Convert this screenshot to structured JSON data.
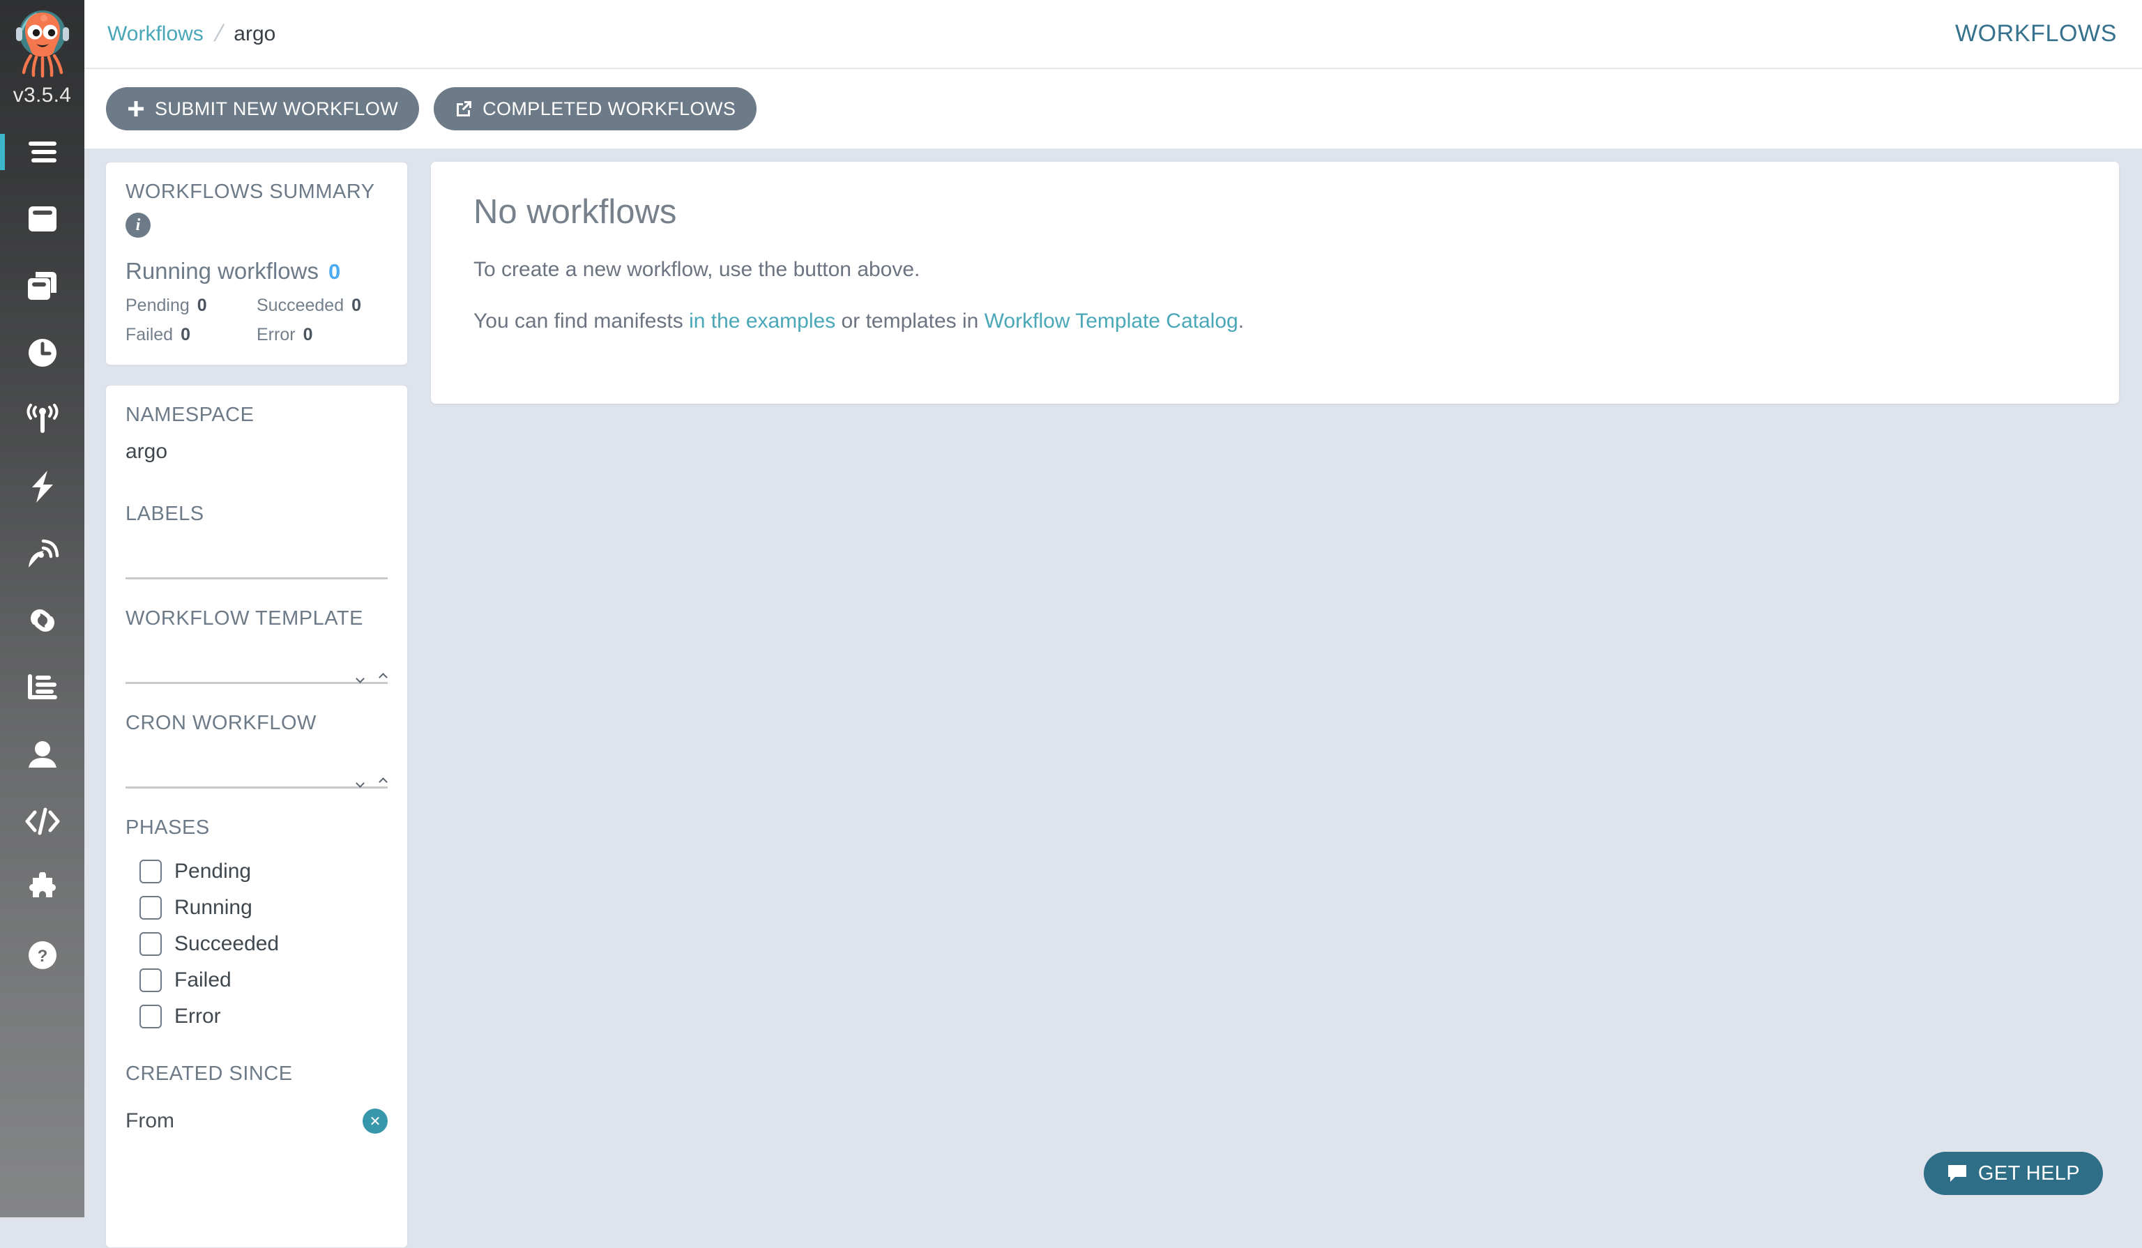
{
  "app": {
    "version": "v3.5.4",
    "logo_icon": "argo-octopus-logo"
  },
  "nav": {
    "items": [
      {
        "icon": "hamburger-menu-icon",
        "name": "nav-item-menu",
        "active": true
      },
      {
        "icon": "window-icon",
        "name": "nav-item-workflows",
        "active": false
      },
      {
        "icon": "copy-windows-icon",
        "name": "nav-item-workflow-templates",
        "active": false
      },
      {
        "icon": "clock-icon",
        "name": "nav-item-cron-workflows",
        "active": false
      },
      {
        "icon": "broadcast-tower-icon",
        "name": "nav-item-event-flow",
        "active": false
      },
      {
        "icon": "lightning-bolt-icon",
        "name": "nav-item-event-sources",
        "active": false
      },
      {
        "icon": "satellite-dish-icon",
        "name": "nav-item-sensors",
        "active": false
      },
      {
        "icon": "link-icon",
        "name": "nav-item-pipelines",
        "active": false
      },
      {
        "icon": "bar-chart-icon",
        "name": "nav-item-reports",
        "active": false
      },
      {
        "icon": "user-icon",
        "name": "nav-item-user",
        "active": false
      },
      {
        "icon": "code-brackets-icon",
        "name": "nav-item-api-docs",
        "active": false
      },
      {
        "icon": "puzzle-piece-icon",
        "name": "nav-item-plugins",
        "active": false
      },
      {
        "icon": "question-circle-icon",
        "name": "nav-item-help",
        "active": false
      }
    ]
  },
  "header": {
    "breadcrumb": {
      "root": "Workflows",
      "separator": "/",
      "current": "argo"
    },
    "title": "WORKFLOWS"
  },
  "action_bar": {
    "submit_label": "SUBMIT NEW WORKFLOW",
    "submit_icon": "plus-icon",
    "completed_label": "COMPLETED WORKFLOWS",
    "completed_icon": "external-link-icon"
  },
  "summary": {
    "title": "WORKFLOWS SUMMARY",
    "info_icon": "info-icon",
    "running_label": "Running workflows",
    "running_count": "0",
    "stats": [
      {
        "label": "Pending",
        "value": "0"
      },
      {
        "label": "Succeeded",
        "value": "0"
      },
      {
        "label": "Failed",
        "value": "0"
      },
      {
        "label": "Error",
        "value": "0"
      }
    ]
  },
  "filters": {
    "namespace_label": "NAMESPACE",
    "namespace_value": "argo",
    "labels_label": "LABELS",
    "labels_value": "",
    "workflow_template_label": "WORKFLOW TEMPLATE",
    "workflow_template_value": "",
    "cron_workflow_label": "CRON WORKFLOW",
    "cron_workflow_value": "",
    "phases_label": "PHASES",
    "phases": [
      {
        "label": "Pending",
        "checked": false
      },
      {
        "label": "Running",
        "checked": false
      },
      {
        "label": "Succeeded",
        "checked": false
      },
      {
        "label": "Failed",
        "checked": false
      },
      {
        "label": "Error",
        "checked": false
      }
    ],
    "created_since_label": "CREATED SINCE",
    "from_label": "From",
    "clear_icon": "close-circle-icon"
  },
  "content": {
    "empty_title": "No workflows",
    "empty_subtitle": "To create a new workflow, use the button above.",
    "hint_prefix": "You can find manifests ",
    "hint_link1": "in the examples",
    "hint_middle": " or templates in ",
    "hint_link2": "Workflow Template Catalog",
    "hint_suffix": "."
  },
  "help": {
    "label": "GET HELP",
    "icon": "chat-bubble-icon"
  },
  "colors": {
    "accent_teal": "#49a7b8",
    "nav_active": "#3cb8c8",
    "header_title": "#36718d",
    "running_count": "#4baaf0",
    "button_gray": "#6d7a88",
    "help_blue": "#2e6e87",
    "page_bg": "#dee3ec"
  }
}
